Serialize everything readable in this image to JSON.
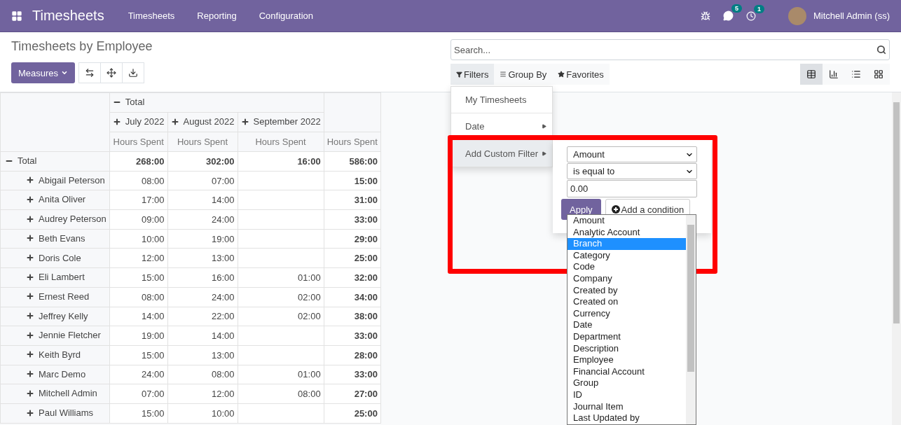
{
  "navbar": {
    "app": "Timesheets",
    "menus": [
      "Timesheets",
      "Reporting",
      "Configuration"
    ],
    "messages_badge": "5",
    "activity_badge": "1",
    "user": "Mitchell Admin (ss)"
  },
  "control_panel": {
    "title": "Timesheets by Employee",
    "measures": "Measures",
    "search": {
      "placeholder": "Search..."
    },
    "filter_buttons": [
      {
        "label": "Filters",
        "kind": "filter",
        "selected": true
      },
      {
        "label": "Group By",
        "kind": "group",
        "selected": false
      },
      {
        "label": "Favorites",
        "kind": "star",
        "selected": false
      }
    ],
    "views": [
      {
        "kind": "pivot",
        "selected": true
      },
      {
        "kind": "graph",
        "selected": false
      },
      {
        "kind": "list",
        "selected": false
      },
      {
        "kind": "kanban",
        "selected": false
      }
    ]
  },
  "filters_menu": {
    "items": [
      {
        "label": "My Timesheets",
        "submenu": false,
        "selected": false
      },
      {
        "label": "Date",
        "submenu": true,
        "selected": false
      },
      {
        "label": "Add Custom Filter",
        "submenu": true,
        "selected": true
      }
    ],
    "custom_filter": {
      "field": "Amount",
      "operator": "is equal to",
      "value": "0.00",
      "apply": "Apply",
      "add_condition": "Add a condition",
      "field_options": [
        {
          "label": "Amount",
          "selected": false
        },
        {
          "label": "Analytic Account",
          "selected": false
        },
        {
          "label": "Branch",
          "selected": true
        },
        {
          "label": "Category",
          "selected": false
        },
        {
          "label": "Code",
          "selected": false
        },
        {
          "label": "Company",
          "selected": false
        },
        {
          "label": "Created by",
          "selected": false
        },
        {
          "label": "Created on",
          "selected": false
        },
        {
          "label": "Currency",
          "selected": false
        },
        {
          "label": "Date",
          "selected": false
        },
        {
          "label": "Department",
          "selected": false
        },
        {
          "label": "Description",
          "selected": false
        },
        {
          "label": "Employee",
          "selected": false
        },
        {
          "label": "Financial Account",
          "selected": false
        },
        {
          "label": "Group",
          "selected": false
        },
        {
          "label": "ID",
          "selected": false
        },
        {
          "label": "Journal Item",
          "selected": false
        },
        {
          "label": "Last Updated by",
          "selected": false
        }
      ]
    }
  },
  "pivot": {
    "column_total": "Total",
    "months": [
      "July 2022",
      "August 2022",
      "September 2022"
    ],
    "measure": [
      "Hours Spent",
      "Hours Spent",
      "Hours Spent",
      "Hours Spent"
    ],
    "total_row": {
      "label": "Total",
      "values": [
        "268:00",
        "302:00",
        "16:00",
        "586:00"
      ]
    },
    "rows": [
      {
        "label": "Abigail Peterson",
        "july": "08:00",
        "august": "07:00",
        "total": "15:00"
      },
      {
        "label": "Anita Oliver",
        "july": "17:00",
        "august": "14:00",
        "total": "31:00"
      },
      {
        "label": "Audrey Peterson",
        "july": "09:00",
        "august": "24:00",
        "total": "33:00"
      },
      {
        "label": "Beth Evans",
        "july": "10:00",
        "august": "19:00",
        "total": "29:00"
      },
      {
        "label": "Doris Cole",
        "july": "12:00",
        "august": "13:00",
        "total": "25:00"
      },
      {
        "label": "Eli Lambert",
        "july": "15:00",
        "august": "16:00",
        "september": "01:00",
        "total": "32:00"
      },
      {
        "label": "Ernest Reed",
        "july": "08:00",
        "august": "24:00",
        "september": "02:00",
        "total": "34:00"
      },
      {
        "label": "Jeffrey Kelly",
        "july": "14:00",
        "august": "22:00",
        "september": "02:00",
        "total": "38:00"
      },
      {
        "label": "Jennie Fletcher",
        "july": "19:00",
        "august": "14:00",
        "total": "33:00"
      },
      {
        "label": "Keith Byrd",
        "july": "15:00",
        "august": "13:00",
        "total": "28:00"
      },
      {
        "label": "Marc Demo",
        "july": "24:00",
        "august": "08:00",
        "september": "01:00",
        "total": "33:00"
      },
      {
        "label": "Mitchell Admin",
        "july": "07:00",
        "august": "12:00",
        "september": "08:00",
        "total": "27:00"
      },
      {
        "label": "Paul Williams",
        "july": "15:00",
        "august": "10:00",
        "total": "25:00"
      }
    ]
  }
}
